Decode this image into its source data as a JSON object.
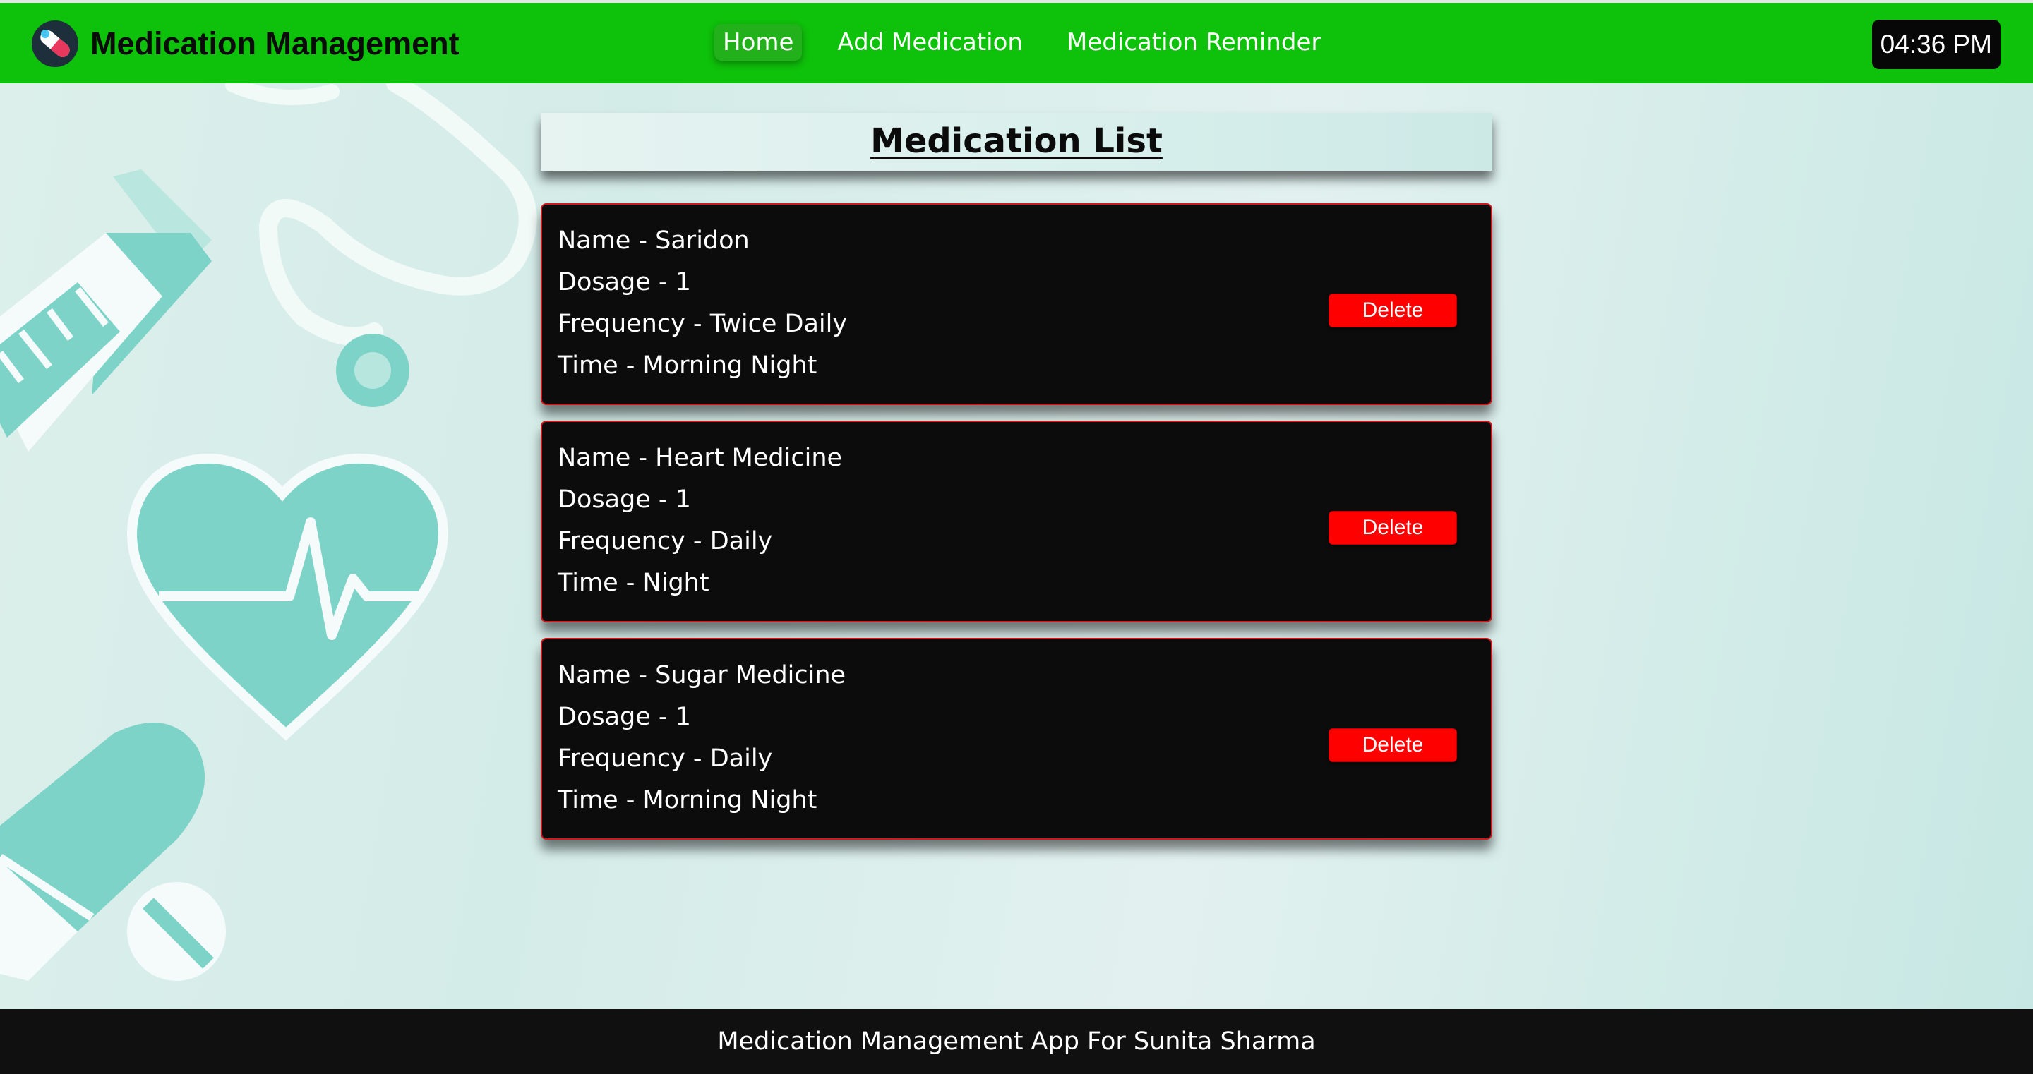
{
  "app": {
    "title": "Medication Management"
  },
  "nav": {
    "items": [
      {
        "label": "Home",
        "active": true
      },
      {
        "label": "Add Medication",
        "active": false
      },
      {
        "label": "Medication Reminder",
        "active": false
      }
    ]
  },
  "clock": {
    "time": "04:36 PM"
  },
  "list": {
    "title": "Medication List",
    "medications": [
      {
        "name": "Name - Saridon",
        "dosage": "Dosage - 1",
        "frequency": "Frequency - Twice Daily",
        "time": "Time - Morning Night",
        "delete_label": "Delete"
      },
      {
        "name": "Name - Heart Medicine",
        "dosage": "Dosage - 1",
        "frequency": "Frequency - Daily",
        "time": "Time - Night",
        "delete_label": "Delete"
      },
      {
        "name": "Name - Sugar Medicine",
        "dosage": "Dosage - 1",
        "frequency": "Frequency - Daily",
        "time": "Time - Morning Night",
        "delete_label": "Delete"
      }
    ]
  },
  "footer": {
    "text": "Medication Management App For Sunita Sharma"
  },
  "colors": {
    "navbar": "#0ec10a",
    "card_background": "#0c0c0d",
    "card_border": "#d2181c",
    "delete_button": "#ff0000",
    "footer": "#101010",
    "medical_teal": "#7dd3c8"
  },
  "icons": {
    "brand": "pill-capsule-icon"
  }
}
